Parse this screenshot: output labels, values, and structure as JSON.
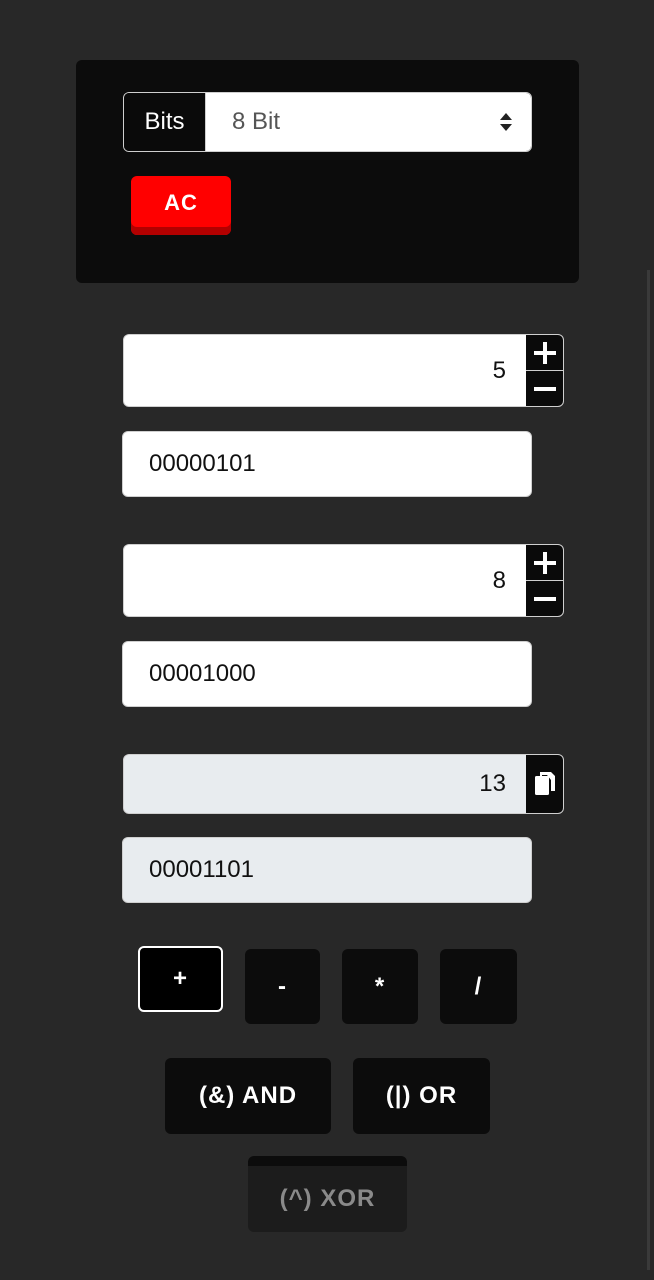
{
  "settings": {
    "bits_label": "Bits",
    "bits_selected": "8 Bit",
    "clear_label": "AC"
  },
  "operand_a": {
    "decimal": "5",
    "binary": "00000101"
  },
  "operand_b": {
    "decimal": "8",
    "binary": "00001000"
  },
  "result": {
    "decimal": "13",
    "binary": "00001101"
  },
  "operators": {
    "add": "+",
    "subtract": "-",
    "multiply": "*",
    "divide": "/",
    "and": "(&) AND",
    "or": "(|) OR",
    "xor": "(^) XOR"
  },
  "colors": {
    "accent_clear": "#ff0000",
    "background": "#282828",
    "panel": "#0c0c0c"
  },
  "icons": {
    "increment": "plus-icon",
    "decrement": "minus-icon",
    "copy": "copy-icon",
    "select": "select-arrows-icon"
  }
}
